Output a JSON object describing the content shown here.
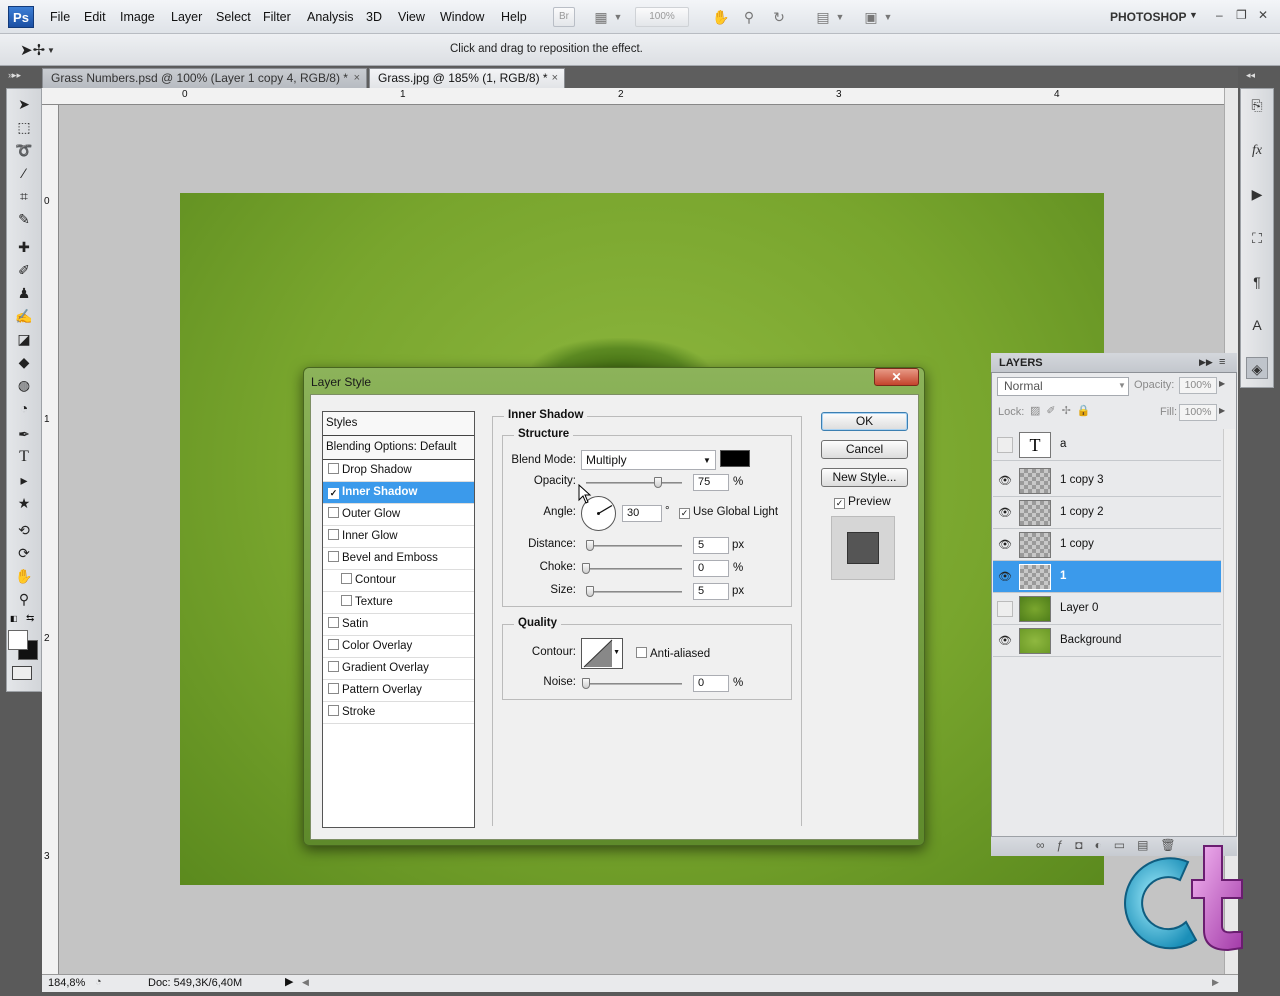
{
  "app": {
    "logo": "Ps",
    "workspace": "PHOTOSHOP"
  },
  "menu": [
    "File",
    "Edit",
    "Image",
    "Layer",
    "Select",
    "Filter",
    "Analysis",
    "3D",
    "View",
    "Window",
    "Help"
  ],
  "toolbar_top": {
    "br_label": "Br",
    "zoom_value": "100%"
  },
  "window_controls": {
    "minimize": "–",
    "restore": "❐",
    "close": "✕"
  },
  "options_bar": {
    "hint": "Click and drag to reposition the effect."
  },
  "tabs": [
    {
      "label": "Grass Numbers.psd @ 100% (Layer 1 copy 4, RGB/8) *",
      "close": "×"
    },
    {
      "label": "Grass.jpg @ 185% (1, RGB/8) *",
      "close": "×"
    }
  ],
  "ruler": {
    "top": [
      "0",
      "1",
      "2",
      "3",
      "4"
    ],
    "left": [
      "0",
      "1",
      "2",
      "3"
    ]
  },
  "status": {
    "zoom": "184,8%",
    "doc": "Doc: 549,3K/6,40M"
  },
  "dialog": {
    "title": "Layer Style",
    "close": "✕",
    "styles_header": "Styles",
    "blending": "Blending Options: Default",
    "styles": [
      {
        "label": "Drop Shadow",
        "checked": false,
        "indent": false
      },
      {
        "label": "Inner Shadow",
        "checked": true,
        "indent": false
      },
      {
        "label": "Outer Glow",
        "checked": false,
        "indent": false
      },
      {
        "label": "Inner Glow",
        "checked": false,
        "indent": false
      },
      {
        "label": "Bevel and Emboss",
        "checked": false,
        "indent": false
      },
      {
        "label": "Contour",
        "checked": false,
        "indent": true
      },
      {
        "label": "Texture",
        "checked": false,
        "indent": true
      },
      {
        "label": "Satin",
        "checked": false,
        "indent": false
      },
      {
        "label": "Color Overlay",
        "checked": false,
        "indent": false
      },
      {
        "label": "Gradient Overlay",
        "checked": false,
        "indent": false
      },
      {
        "label": "Pattern Overlay",
        "checked": false,
        "indent": false
      },
      {
        "label": "Stroke",
        "checked": false,
        "indent": false
      }
    ],
    "section_title": "Inner Shadow",
    "structure_title": "Structure",
    "blend_mode_label": "Blend Mode:",
    "blend_mode_value": "Multiply",
    "shadow_color": "#000000",
    "opacity_label": "Opacity:",
    "opacity_value": "75",
    "opacity_fraction": 0.75,
    "angle_label": "Angle:",
    "angle_value": "30",
    "degree": "°",
    "use_global_light": "Use Global Light",
    "distance_label": "Distance:",
    "distance_value": "5",
    "choke_label": "Choke:",
    "choke_value": "0",
    "size_label": "Size:",
    "size_value": "5",
    "quality_title": "Quality",
    "contour_label": "Contour:",
    "anti_aliased": "Anti-aliased",
    "noise_label": "Noise:",
    "noise_value": "0",
    "pct": "%",
    "px": "px",
    "ok": "OK",
    "cancel": "Cancel",
    "new_style": "New Style...",
    "preview": "Preview"
  },
  "layers_panel": {
    "title": "LAYERS",
    "blend_mode": "Normal",
    "opacity_label": "Opacity:",
    "opacity_value": "100%",
    "lock_label": "Lock:",
    "fill_label": "Fill:",
    "fill_value": "100%",
    "layers": [
      {
        "name": "a",
        "visible": false,
        "thumb": "text",
        "thumb_text": "T",
        "selected": false
      },
      {
        "name": "1 copy 3",
        "visible": true,
        "thumb": "checker",
        "selected": false
      },
      {
        "name": "1 copy 2",
        "visible": true,
        "thumb": "checker",
        "selected": false
      },
      {
        "name": "1 copy",
        "visible": true,
        "thumb": "checker",
        "selected": false
      },
      {
        "name": "1",
        "visible": true,
        "thumb": "checker",
        "selected": true
      },
      {
        "name": "Layer 0",
        "visible": false,
        "thumb": "grass",
        "selected": false
      },
      {
        "name": "Background",
        "visible": true,
        "thumb": "grass2",
        "selected": false
      }
    ]
  },
  "colors": {
    "selection": "#3b9aeb",
    "dialog_frame": "#6f9a38",
    "grass": "#7aa62e"
  }
}
